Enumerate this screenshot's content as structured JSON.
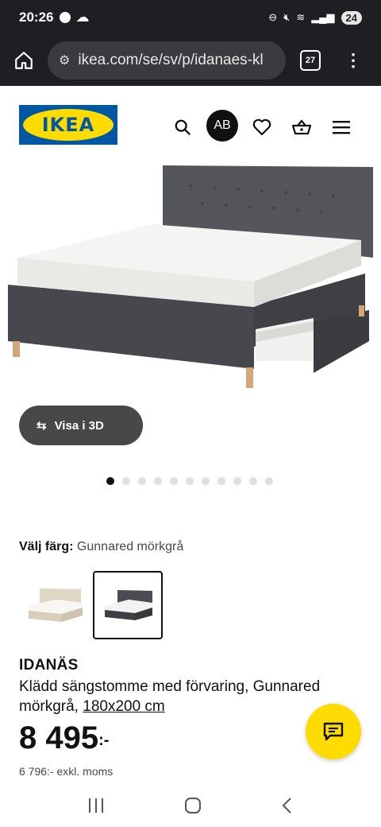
{
  "status_bar": {
    "time": "20:26",
    "battery": "24"
  },
  "browser": {
    "url": "ikea.com/se/sv/p/idanaes-kl",
    "tab_count": "27"
  },
  "header": {
    "logo_text": "IKEA",
    "avatar_initials": "AB"
  },
  "gallery": {
    "view3d_label": "Visa i 3D",
    "dot_count": 11,
    "active_dot": 0
  },
  "color_picker": {
    "label": "Välj färg:",
    "selected_value": "Gunnared mörkgrå"
  },
  "product": {
    "name": "IDANÄS",
    "description": "Klädd sängstomme med förvaring, Gunnared mörkgrå,",
    "size_link": "180x200 cm",
    "price": "8 495",
    "price_suffix": ":-",
    "price_ex_vat": "6 796:- exkl. moms"
  },
  "colors": {
    "accent": "#ffdb00",
    "brand_blue": "#0058a3",
    "dark": "#1e1f22"
  }
}
